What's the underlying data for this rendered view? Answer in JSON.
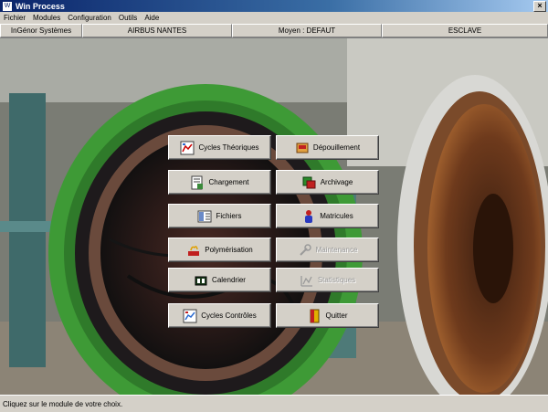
{
  "window": {
    "title": "Win Process",
    "close_glyph": "×"
  },
  "menu": [
    "Fichier",
    "Modules",
    "Configuration",
    "Outils",
    "Aide"
  ],
  "infobar": [
    "InGénor Systèmes",
    "AIRBUS NANTES",
    "Moyen : DEFAUT",
    "ESCLAVE"
  ],
  "buttons": [
    {
      "label": "Cycles Théoriques",
      "icon": "cycles-chart-icon",
      "enabled": true
    },
    {
      "label": "Dépouillement",
      "icon": "depouillement-icon",
      "enabled": true
    },
    {
      "label": "Chargement",
      "icon": "chargement-icon",
      "enabled": true
    },
    {
      "label": "Archivage",
      "icon": "archivage-icon",
      "enabled": true
    },
    {
      "label": "Fichiers",
      "icon": "fichiers-icon",
      "enabled": true
    },
    {
      "label": "Matricules",
      "icon": "matricules-icon",
      "enabled": true
    },
    {
      "label": "Polymérisation",
      "icon": "polymerisation-icon",
      "enabled": true
    },
    {
      "label": "Maintenance",
      "icon": "wrench-icon",
      "enabled": false
    },
    {
      "label": "Calendrier",
      "icon": "calendar-icon",
      "enabled": true
    },
    {
      "label": "Statistiques",
      "icon": "statistics-icon",
      "enabled": false
    },
    {
      "label": "Cycles Contrôles",
      "icon": "cycles-controles-icon",
      "enabled": true
    },
    {
      "label": "Quitter",
      "icon": "exit-door-icon",
      "enabled": true
    }
  ],
  "status": "Cliquez sur le module de votre choix.",
  "colors": {
    "titlebar": "#0a246a",
    "face": "#d4d0c8",
    "autoclave_ring": "#3e9a36"
  }
}
